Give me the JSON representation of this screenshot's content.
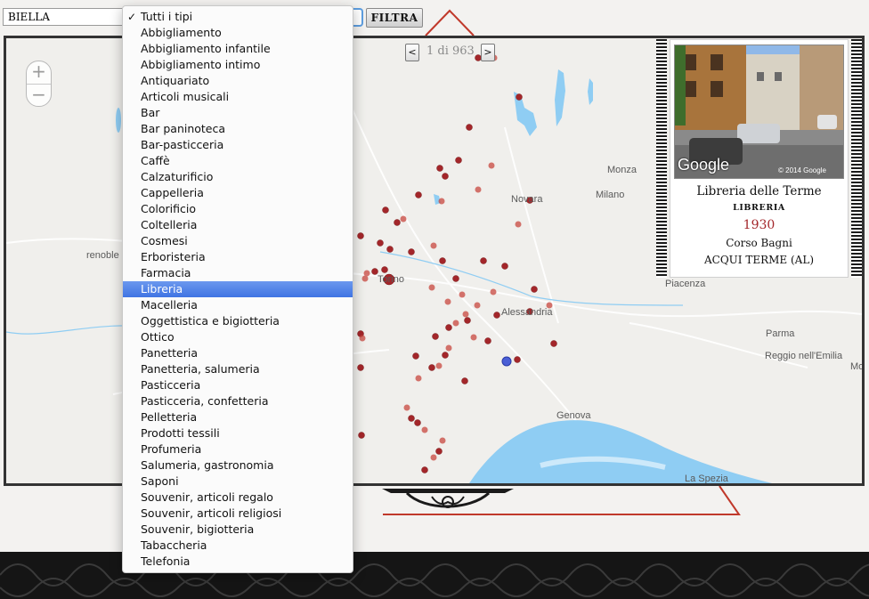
{
  "filters": {
    "city_value": "BIELLA",
    "filter_button": "FILTRA"
  },
  "dropdown": {
    "items": [
      "Tutti i tipi",
      "Abbigliamento",
      "Abbigliamento infantile",
      "Abbigliamento intimo",
      "Antiquariato",
      "Articoli musicali",
      "Bar",
      "Bar paninoteca",
      "Bar-pasticceria",
      "Caffè",
      "Calzaturificio",
      "Cappelleria",
      "Colorificio",
      "Coltelleria",
      "Cosmesi",
      "Erboristeria",
      "Farmacia",
      "Libreria",
      "Macelleria",
      "Oggettistica e bigiotteria",
      "Ottico",
      "Panetteria",
      "Panetteria, salumeria",
      "Pasticceria",
      "Pasticceria, confetteria",
      "Pelletteria",
      "Prodotti tessili",
      "Profumeria",
      "Salumeria, gastronomia",
      "Saponi",
      "Souvenir, articoli regalo",
      "Souvenir, articoli religiosi",
      "Souvenir, bigiotteria",
      "Tabaccheria",
      "Telefonia"
    ],
    "checked_item": "Tutti i tipi",
    "highlighted_item": "Libreria"
  },
  "pager": {
    "prev": "<",
    "next": ">",
    "text": "1 di 963"
  },
  "map": {
    "zoom_in": "+",
    "zoom_out": "−",
    "labels": {
      "monza": "Monza",
      "novara": "Novara",
      "milano": "Milano",
      "grenoble": "renoble",
      "torino": "Torino",
      "alessandria": "Alessandria",
      "piacenza": "Piacenza",
      "parma": "Parma",
      "reggio": "Reggio nell'Emilia",
      "mo": "Mo",
      "genova": "Genova",
      "la_spezia": "La Spezia"
    },
    "marker_color": "#a3262a",
    "water_color": "#8fcdf3"
  },
  "card": {
    "name": "Libreria delle Terme",
    "category": "LIBRERIA",
    "year": "1930",
    "street": "Corso Bagni",
    "city": "ACQUI TERME (AL)",
    "photo_watermark": "Google",
    "photo_copyright": "© 2014 Google"
  }
}
